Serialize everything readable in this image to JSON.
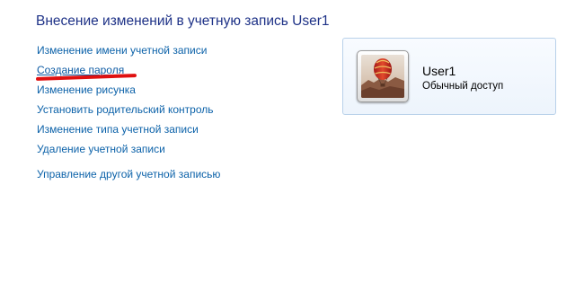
{
  "page": {
    "title": "Внесение изменений в учетную запись User1"
  },
  "tasks": [
    {
      "label": "Изменение имени учетной записи"
    },
    {
      "label": "Создание пароля"
    },
    {
      "label": "Изменение рисунка"
    },
    {
      "label": "Установить родительский контроль"
    },
    {
      "label": "Изменение типа учетной записи"
    },
    {
      "label": "Удаление учетной записи"
    }
  ],
  "other": {
    "manage_label": "Управление другой учетной записью"
  },
  "account": {
    "name": "User1",
    "type": "Обычный доступ",
    "avatar_icon": "hot-air-balloon-picture"
  },
  "colors": {
    "link": "#0c62a9",
    "title": "#1e3287",
    "highlight_mark": "#e01010",
    "card_border": "#b9d1ea"
  }
}
